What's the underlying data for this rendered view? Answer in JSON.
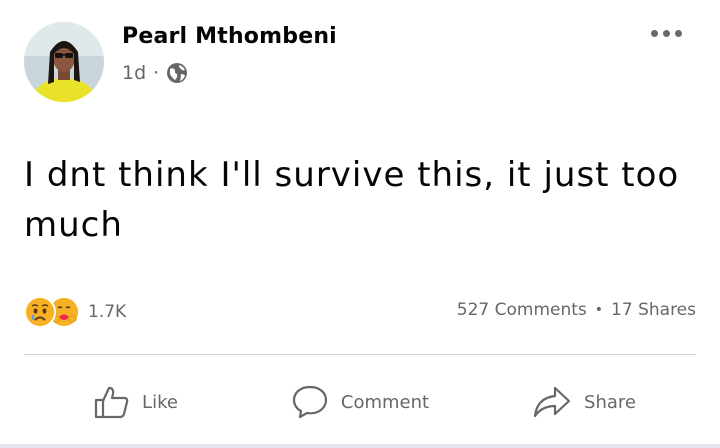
{
  "post": {
    "author": "Pearl Mthombeni",
    "time": "1d",
    "separator": "·",
    "audience_icon": "globe-icon",
    "text": "I dnt think I'll survive this, it just too much",
    "reactions": {
      "icons": [
        "sad-reaction",
        "care-reaction"
      ],
      "count": "1.7K"
    },
    "comments": "527 Comments",
    "dot": "•",
    "shares": "17 Shares"
  },
  "actions": {
    "like": "Like",
    "comment": "Comment",
    "share": "Share"
  },
  "colors": {
    "text": "#050505",
    "muted": "#65676b",
    "divider": "#ced0d4",
    "reaction": "#f7b125"
  }
}
